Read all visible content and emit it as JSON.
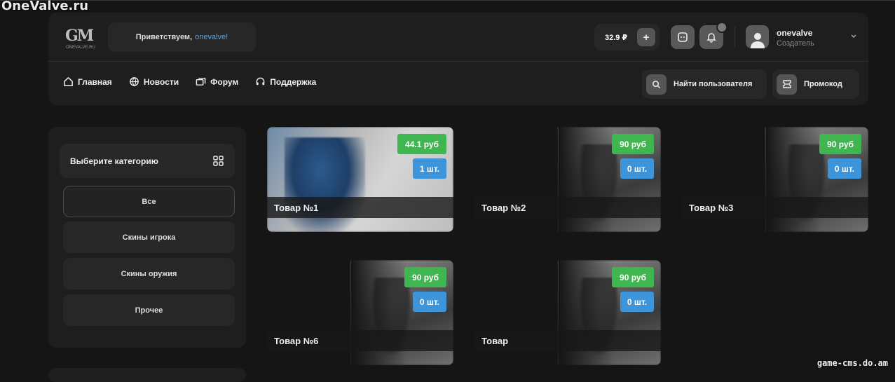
{
  "watermarks": {
    "top_left": "OneValve.ru",
    "bottom_right": "game-cms.do.am"
  },
  "logo": {
    "mark": "GM",
    "subtext": "ONEVALVE.RU"
  },
  "greeting": {
    "prefix": "Приветствуем,",
    "username": "onevalve!"
  },
  "balance": {
    "amount": "32.9 ₽",
    "add_label": "+"
  },
  "user": {
    "name": "onevalve",
    "role": "Создатель"
  },
  "nav": [
    {
      "label": "Главная",
      "icon": "home-icon"
    },
    {
      "label": "Новости",
      "icon": "globe-icon"
    },
    {
      "label": "Форум",
      "icon": "forum-icon"
    },
    {
      "label": "Поддержка",
      "icon": "headset-icon"
    }
  ],
  "actions": {
    "find_user": "Найти пользователя",
    "promo": "Промокод"
  },
  "sidebar": {
    "heading": "Выберите категорию",
    "categories": [
      "Все",
      "Скины игрока",
      "Скины оружия",
      "Прочее"
    ],
    "active": "Все"
  },
  "products": [
    {
      "title": "Товар №1",
      "price": "44.1 руб",
      "stock": "1 шт."
    },
    {
      "title": "Товар №2",
      "price": "90 руб",
      "stock": "0 шт."
    },
    {
      "title": "Товар №3",
      "price": "90 руб",
      "stock": "0 шт."
    },
    {
      "title": "Товар №6",
      "price": "90 руб",
      "stock": "0 шт."
    },
    {
      "title": "Товар",
      "price": "90 руб",
      "stock": "0 шт."
    }
  ],
  "colors": {
    "price": "#3fb650",
    "stock": "#3d94d8",
    "accent": "#5aa4e6",
    "panel": "#1e1e1e"
  }
}
